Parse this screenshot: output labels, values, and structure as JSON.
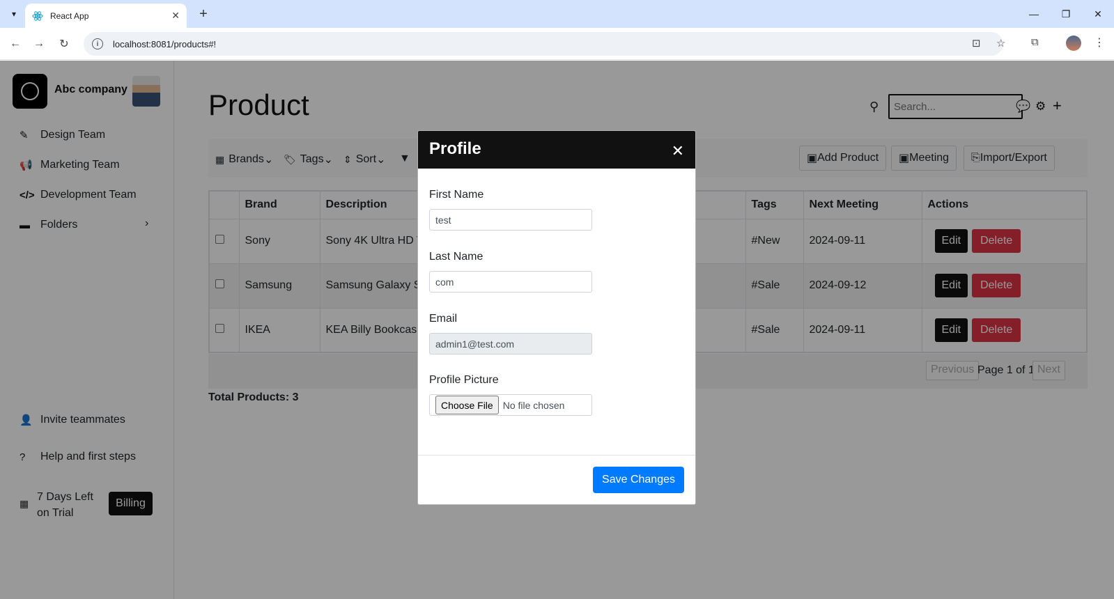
{
  "browser": {
    "tab_title": "React App",
    "url": "localhost:8081/products#!"
  },
  "sidebar": {
    "company": "Abc company",
    "items": [
      {
        "label": "Design Team",
        "icon": "design-icon"
      },
      {
        "label": "Marketing Team",
        "icon": "megaphone-icon"
      },
      {
        "label": "Development Team",
        "icon": "code-icon"
      },
      {
        "label": "Folders",
        "icon": "folder-icon"
      }
    ],
    "bottom": {
      "invite": "Invite teammates",
      "help": "Help and first steps",
      "trial_line1": "7 Days Left",
      "trial_line2": "on Trial",
      "billing": "Billing"
    }
  },
  "main": {
    "title": "Product",
    "search_placeholder": "Search...",
    "filters": {
      "brands": "Brands",
      "tags": "Tags",
      "sort": "Sort"
    },
    "actions": {
      "add_product": "Add Product",
      "meeting": "Meeting",
      "import_export": "Import/Export"
    },
    "table": {
      "headers": [
        "Brand",
        "Description",
        "Tags",
        "Next Meeting",
        "Actions"
      ],
      "rows": [
        {
          "brand": "Sony",
          "description": "Sony 4K Ultra HD T",
          "tags": "#New",
          "next_meeting": "2024-09-11"
        },
        {
          "brand": "Samsung",
          "description": "Samsung Galaxy S",
          "tags": "#Sale",
          "next_meeting": "2024-09-12"
        },
        {
          "brand": "IKEA",
          "description": "KEA Billy Bookcase",
          "tags": "#Sale",
          "next_meeting": "2024-09-11"
        }
      ],
      "edit_label": "Edit",
      "delete_label": "Delete"
    },
    "pagination": {
      "previous": "Previous",
      "page_text": "Page 1 of 1",
      "next": "Next"
    },
    "total": "Total Products: 3"
  },
  "modal": {
    "title": "Profile",
    "first_name_label": "First Name",
    "first_name_value": "test",
    "last_name_label": "Last Name",
    "last_name_value": "com",
    "email_label": "Email",
    "email_value": "admin1@test.com",
    "picture_label": "Profile Picture",
    "choose_file": "Choose File",
    "no_file": "No file chosen",
    "save": "Save Changes"
  }
}
